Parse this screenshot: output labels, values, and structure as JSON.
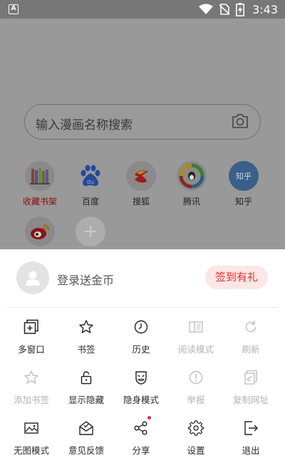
{
  "status_bar": {
    "time": "3:43",
    "app_badge": "A"
  },
  "search": {
    "placeholder": "输入漫画名称搜索"
  },
  "sites": [
    {
      "label": "收藏书架",
      "icon": "bookshelf-icon"
    },
    {
      "label": "百度",
      "icon": "baidu-icon"
    },
    {
      "label": "搜狐",
      "icon": "sohu-icon"
    },
    {
      "label": "腾讯",
      "icon": "tencent-icon"
    },
    {
      "label": "知乎",
      "icon": "zhihu-icon",
      "icon_text": "知乎"
    },
    {
      "label": "",
      "icon": "weibo-icon"
    },
    {
      "label": "",
      "icon": "add-icon",
      "icon_text": "+"
    }
  ],
  "account": {
    "login_text": "登录送金币",
    "checkin_label": "签到有礼"
  },
  "menu": {
    "row1": [
      {
        "label": "多窗口",
        "icon": "multi-window-icon"
      },
      {
        "label": "书签",
        "icon": "star-icon"
      },
      {
        "label": "历史",
        "icon": "clock-icon"
      },
      {
        "label": "阅读模式",
        "icon": "reader-mode-icon",
        "disabled": true
      },
      {
        "label": "刷新",
        "icon": "refresh-icon",
        "disabled": true
      }
    ],
    "row2": [
      {
        "label": "添加书签",
        "icon": "add-bookmark-icon",
        "disabled": true
      },
      {
        "label": "显示隐藏",
        "icon": "lock-icon"
      },
      {
        "label": "隐身模式",
        "icon": "mask-icon"
      },
      {
        "label": "举报",
        "icon": "report-icon",
        "disabled": true
      },
      {
        "label": "复制网址",
        "icon": "copy-link-icon",
        "disabled": true
      }
    ],
    "row3": [
      {
        "label": "无图模式",
        "icon": "no-image-icon"
      },
      {
        "label": "意见反馈",
        "icon": "feedback-icon"
      },
      {
        "label": "分享",
        "icon": "share-icon",
        "badge": true
      },
      {
        "label": "设置",
        "icon": "gear-icon"
      },
      {
        "label": "退出",
        "icon": "exit-icon"
      }
    ]
  },
  "colors": {
    "accent": "#e0322e",
    "checkin_bg": "#fbe7e6",
    "scrim": "#999999"
  }
}
